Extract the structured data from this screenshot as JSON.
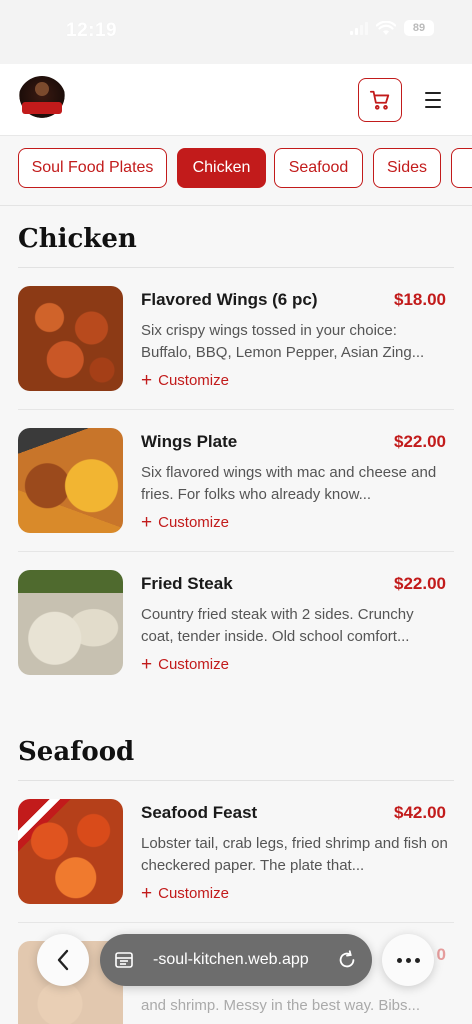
{
  "status": {
    "time": "12:19",
    "battery": "89"
  },
  "header": {
    "logo_alt": "Soul Kitchen logo"
  },
  "tabs": [
    {
      "label": "Soul Food Plates",
      "active": false
    },
    {
      "label": "Chicken",
      "active": true
    },
    {
      "label": "Seafood",
      "active": false
    },
    {
      "label": "Sides",
      "active": false
    }
  ],
  "sections": [
    {
      "title": "Chicken",
      "items": [
        {
          "name": "Flavored Wings (6 pc)",
          "price": "$18.00",
          "description": "Six crispy wings tossed in your choice: Buffalo, BBQ, Lemon Pepper, Asian Zing...",
          "action": "Customize"
        },
        {
          "name": "Wings Plate",
          "price": "$22.00",
          "description": "Six flavored wings with mac and cheese and fries. For folks who already know...",
          "action": "Customize"
        },
        {
          "name": "Fried Steak",
          "price": "$22.00",
          "description": "Country fried steak with 2 sides. Crunchy coat, tender inside. Old school comfort...",
          "action": "Customize"
        }
      ]
    },
    {
      "title": "Seafood",
      "items": [
        {
          "name": "Seafood Feast",
          "price": "$42.00",
          "description": "Lobster tail, crab legs, fried shrimp and fish on checkered paper. The plate that...",
          "action": "Customize"
        },
        {
          "name": "",
          "price": "0",
          "description": "and shrimp. Messy in the best way. Bibs...",
          "action": ""
        }
      ]
    }
  ],
  "browser": {
    "url": "-soul-kitchen.web.app"
  },
  "colors": {
    "accent": "#c21b1b",
    "background": "#f7f7f7"
  }
}
